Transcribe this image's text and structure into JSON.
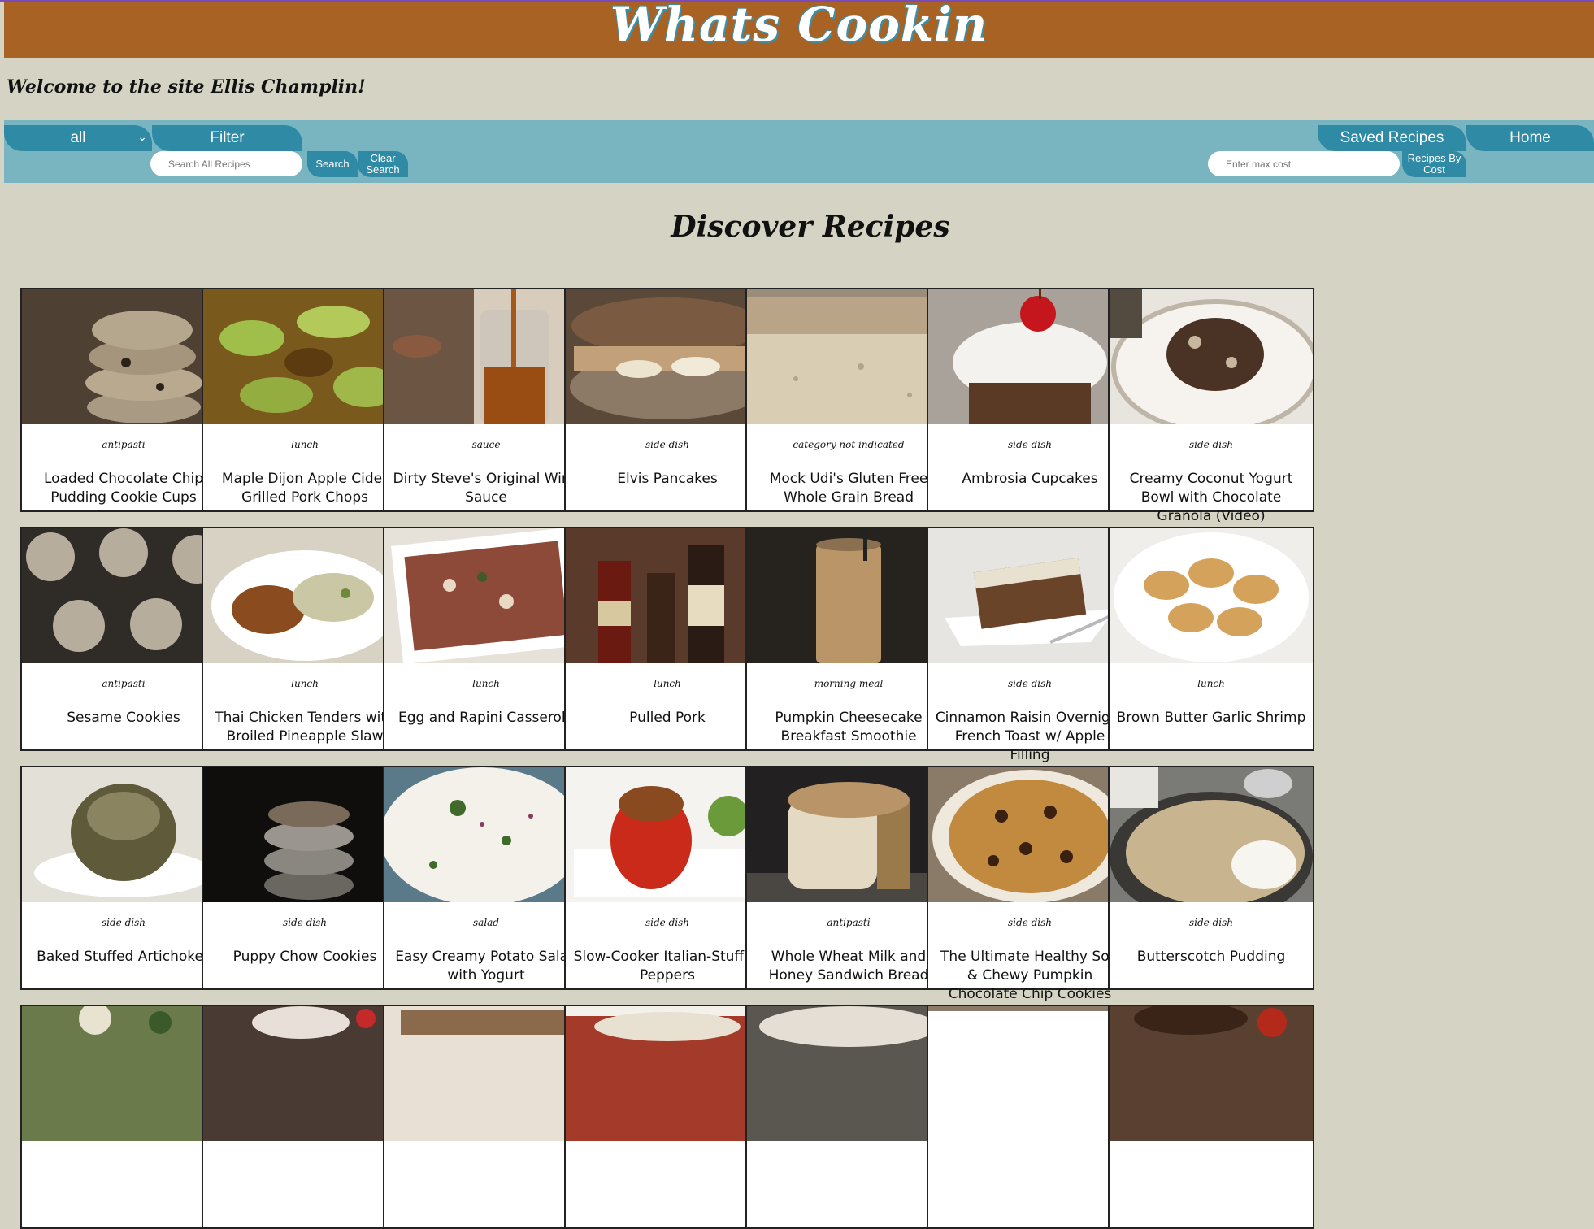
{
  "header": {
    "title": "Whats Cookin"
  },
  "welcome": "Welcome to the site Ellis Champlin!",
  "nav": {
    "type_select": "all",
    "filter_label": "Filter",
    "search_placeholder": "Search All Recipes",
    "search_label": "Search",
    "clear_label": "Clear Search",
    "saved_label": "Saved Recipes",
    "home_label": "Home",
    "cost_placeholder": "Enter max cost",
    "by_cost_label": "Recipes By Cost"
  },
  "main": {
    "title": "Discover Recipes",
    "recipes": [
      {
        "category": "antipasti",
        "name": "Loaded Chocolate Chip Pudding Cookie Cups",
        "img": "cookie-stack"
      },
      {
        "category": "lunch",
        "name": "Maple Dijon Apple Cider Grilled Pork Chops",
        "img": "apples"
      },
      {
        "category": "sauce",
        "name": "Dirty Steve's Original Wing Sauce",
        "img": "jar"
      },
      {
        "category": "side dish",
        "name": "Elvis Pancakes",
        "img": "pancakes"
      },
      {
        "category": "category not indicated",
        "name": "Mock Udi's Gluten Free Whole Grain Bread",
        "img": "bread"
      },
      {
        "category": "side dish",
        "name": "Ambrosia Cupcakes",
        "img": "cupcake"
      },
      {
        "category": "side dish",
        "name": "Creamy Coconut Yogurt Bowl with Chocolate Granola (Video)",
        "img": "bowl"
      },
      {
        "category": "antipasti",
        "name": "Sesame Cookies",
        "img": "cookies-rack"
      },
      {
        "category": "lunch",
        "name": "Thai Chicken Tenders with Broiled Pineapple Slaw",
        "img": "plate-chicken"
      },
      {
        "category": "lunch",
        "name": "Egg and Rapini Casserole",
        "img": "casserole"
      },
      {
        "category": "lunch",
        "name": "Pulled Pork",
        "img": "sauces"
      },
      {
        "category": "morning meal",
        "name": "Pumpkin Cheesecake Breakfast Smoothie",
        "img": "smoothie"
      },
      {
        "category": "side dish",
        "name": "Cinnamon Raisin Overnight French Toast w/ Apple Filling",
        "img": "french-toast"
      },
      {
        "category": "lunch",
        "name": "Brown Butter Garlic Shrimp",
        "img": "shrimp"
      },
      {
        "category": "side dish",
        "name": "Baked Stuffed Artichokes",
        "img": "artichoke"
      },
      {
        "category": "side dish",
        "name": "Puppy Chow Cookies",
        "img": "dark-cookies"
      },
      {
        "category": "salad",
        "name": "Easy Creamy Potato Salad with Yogurt",
        "img": "potato-salad"
      },
      {
        "category": "side dish",
        "name": "Slow-Cooker Italian-Stuffed Peppers",
        "img": "pepper"
      },
      {
        "category": "antipasti",
        "name": "Whole Wheat Milk and Honey Sandwich Bread",
        "img": "loaf"
      },
      {
        "category": "side dish",
        "name": "The Ultimate Healthy Soft & Chewy Pumpkin Chocolate Chip Cookies",
        "img": "pumpkin-cookie"
      },
      {
        "category": "side dish",
        "name": "Butterscotch Pudding",
        "img": "pudding"
      },
      {
        "category": "",
        "name": "",
        "img": "partial-1"
      },
      {
        "category": "",
        "name": "",
        "img": "partial-2"
      },
      {
        "category": "",
        "name": "",
        "img": "partial-3"
      },
      {
        "category": "",
        "name": "",
        "img": "partial-4"
      },
      {
        "category": "",
        "name": "",
        "img": "partial-5"
      },
      {
        "category": "",
        "name": "",
        "img": "partial-6"
      },
      {
        "category": "",
        "name": "",
        "img": "partial-7"
      }
    ]
  },
  "colors": {
    "background": "#d5d3c3",
    "banner": "#a86324",
    "navbar": "#78b5c0",
    "tab": "#2f8aa5"
  }
}
